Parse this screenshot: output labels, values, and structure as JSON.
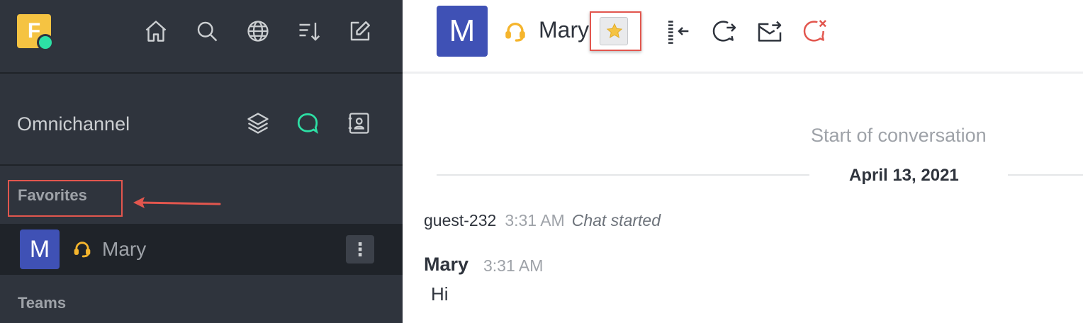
{
  "sidebar": {
    "workspace_initial": "F",
    "header_icons": [
      "home-icon",
      "search-icon",
      "directory-icon",
      "sort-icon",
      "create-new-icon"
    ],
    "omnichannel": {
      "label": "Omnichannel",
      "icons": [
        "queue-icon",
        "omnichannel-chat-icon",
        "contact-center-icon"
      ]
    },
    "favorites_title": "Favorites",
    "favorite_room": {
      "initial": "M",
      "name": "Mary",
      "status_icon": "headset-icon",
      "menu_icon": "kebab-menu-icon"
    },
    "teams_title": "Teams"
  },
  "room_header": {
    "avatar_initial": "M",
    "name": "Mary",
    "favorite_icon": "star-icon",
    "toolbar_icons": [
      "room-info-icon",
      "forward-chat-icon",
      "transcript-icon",
      "close-chat-icon"
    ]
  },
  "conversation": {
    "start_label": "Start of conversation",
    "date_divider": "April 13, 2021",
    "system_message": {
      "user": "guest-232",
      "time": "3:31 AM",
      "text": "Chat started"
    },
    "message": {
      "user": "Mary",
      "time": "3:31 AM",
      "body": "Hi"
    }
  },
  "colors": {
    "sidebar_bg": "#2f343d",
    "selected_row_bg": "#1f2329",
    "avatar_blue": "#3f51b5",
    "workspace_yellow": "#f5c342",
    "omnichannel_green": "#2de0a5",
    "highlight_red": "#e2564e",
    "star_yellow": "#f5c342"
  }
}
